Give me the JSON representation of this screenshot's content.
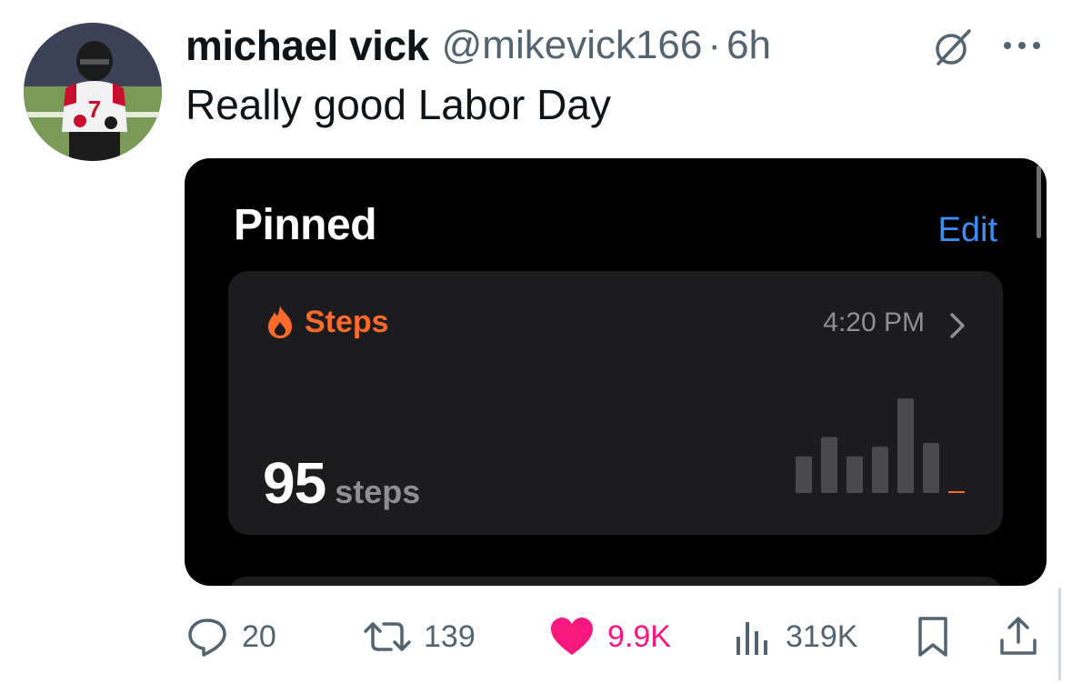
{
  "post": {
    "author_name": "michael vick",
    "author_handle": "@mikevick166",
    "separator": "·",
    "time_ago": "6h",
    "text": "Really good Labor Day",
    "avatar_icon": "avatar-photo",
    "header_icons": [
      "grok-icon",
      "more-icon"
    ]
  },
  "media": {
    "section_title": "Pinned",
    "edit_label": "Edit",
    "card": {
      "metric_label": "Steps",
      "metric_icon": "flame-icon",
      "time": "4:20 PM",
      "chevron_icon": "chevron-right-icon",
      "value": "95",
      "unit": "steps",
      "accent_color": "#ff6a2a",
      "mini_chart_values": [
        0.38,
        0.58,
        0.38,
        0.48,
        0.98,
        0.52,
        0.02
      ]
    }
  },
  "actions": {
    "reply_count": "20",
    "repost_count": "139",
    "like_count": "9.9K",
    "view_count": "319K",
    "like_color": "#f91880"
  }
}
